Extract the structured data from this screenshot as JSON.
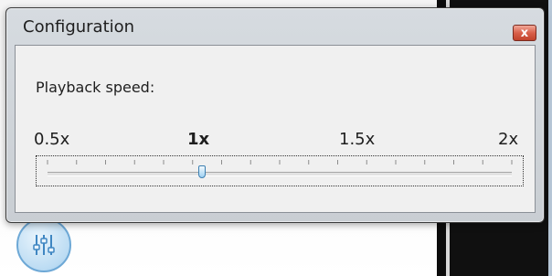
{
  "window": {
    "title": "Configuration",
    "close_glyph": "x"
  },
  "playback": {
    "label": "Playback speed:",
    "tick_labels": [
      "0.5x",
      "1x",
      "1.5x",
      "2x"
    ],
    "current_value_label": "1x",
    "min": 0.5,
    "max": 2,
    "value": 1,
    "minor_ticks": 16
  },
  "icons": {
    "close": "close-icon",
    "equalizer": "equalizer-icon"
  },
  "colors": {
    "thumb_accent": "#9fd1f2",
    "close_button": "#d8604a"
  }
}
